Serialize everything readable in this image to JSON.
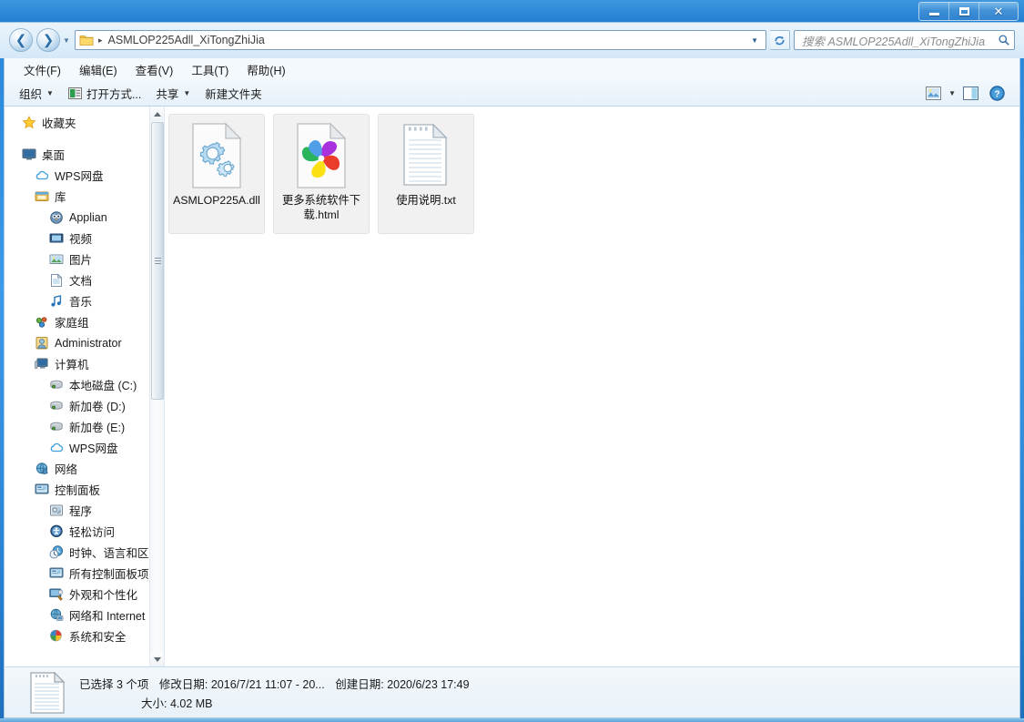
{
  "window": {
    "title": "",
    "controls": {
      "minimize_label": "最小化",
      "maximize_label": "最大化",
      "close_label": "关闭"
    }
  },
  "navbar": {
    "back_label": "后退",
    "forward_label": "前进",
    "recent_pages_label": "最近的页面",
    "address_path": "ASMLOP225Adll_XiTongZhiJia",
    "address_separator": "▸",
    "refresh_label": "刷新",
    "search_placeholder": "搜索 ASMLOP225Adll_XiTongZhiJia"
  },
  "menubar": {
    "items": [
      {
        "label": "文件(F)",
        "name": "menu-file"
      },
      {
        "label": "编辑(E)",
        "name": "menu-edit"
      },
      {
        "label": "查看(V)",
        "name": "menu-view"
      },
      {
        "label": "工具(T)",
        "name": "menu-tools"
      },
      {
        "label": "帮助(H)",
        "name": "menu-help"
      }
    ]
  },
  "toolbar": {
    "organize_label": "组织",
    "open_with_label": "打开方式...",
    "share_label": "共享",
    "new_folder_label": "新建文件夹",
    "change_view_label": "更改您的视图",
    "preview_pane_label": "显示预览窗格",
    "help_label": "获取帮助"
  },
  "sidebar": {
    "items": [
      {
        "label": "收藏夹",
        "icon": "star-icon",
        "level": 0,
        "gap_after": true
      },
      {
        "label": "桌面",
        "icon": "desktop-icon",
        "level": 0
      },
      {
        "label": "WPS网盘",
        "icon": "cloud-icon",
        "level": 1
      },
      {
        "label": "库",
        "icon": "library-icon",
        "level": 1
      },
      {
        "label": "Applian",
        "icon": "owl-icon",
        "level": 2
      },
      {
        "label": "视频",
        "icon": "video-icon",
        "level": 2
      },
      {
        "label": "图片",
        "icon": "picture-icon",
        "level": 2
      },
      {
        "label": "文档",
        "icon": "document-icon",
        "level": 2
      },
      {
        "label": "音乐",
        "icon": "music-icon",
        "level": 2
      },
      {
        "label": "家庭组",
        "icon": "homegroup-icon",
        "level": 1
      },
      {
        "label": "Administrator",
        "icon": "user-icon",
        "level": 1
      },
      {
        "label": "计算机",
        "icon": "computer-icon",
        "level": 1
      },
      {
        "label": "本地磁盘 (C:)",
        "icon": "harddisk-icon",
        "level": 2
      },
      {
        "label": "新加卷 (D:)",
        "icon": "harddisk-icon",
        "level": 2
      },
      {
        "label": "新加卷 (E:)",
        "icon": "harddisk-icon",
        "level": 2
      },
      {
        "label": "WPS网盘",
        "icon": "cloud-icon",
        "level": 2
      },
      {
        "label": "网络",
        "icon": "network-icon",
        "level": 1
      },
      {
        "label": "控制面板",
        "icon": "controlpanel-icon",
        "level": 1
      },
      {
        "label": "程序",
        "icon": "programs-icon",
        "level": 2
      },
      {
        "label": "轻松访问",
        "icon": "ease-of-access-icon",
        "level": 2
      },
      {
        "label": "时钟、语言和区域",
        "icon": "clock-icon",
        "level": 2
      },
      {
        "label": "所有控制面板项",
        "icon": "controlpanel-icon",
        "level": 2
      },
      {
        "label": "外观和个性化",
        "icon": "appearance-icon",
        "level": 2
      },
      {
        "label": "网络和 Internet",
        "icon": "network-internet-icon",
        "level": 2
      },
      {
        "label": "系统和安全",
        "icon": "system-security-icon",
        "level": 2
      }
    ]
  },
  "files": [
    {
      "name": "ASMLOP225A.dll",
      "icon": "dll-gear-file-icon",
      "selected": true
    },
    {
      "name": "更多系统软件下载.html",
      "icon": "html-pinwheel-file-icon",
      "selected": true
    },
    {
      "name": "使用说明.txt",
      "icon": "text-file-icon",
      "selected": true
    }
  ],
  "statusbar": {
    "selected_count_text": "已选择 3 个项",
    "modified_label": "修改日期:",
    "modified_value": "2016/7/21 11:07 - 20...",
    "created_label": "创建日期:",
    "created_value": "2020/6/23 17:49",
    "size_label": "大小:",
    "size_value": "4.02 MB"
  },
  "colors": {
    "titlebar_blue": "#2f8bd9",
    "frame_border": "#a8c8e4",
    "content_bg": "#ffffff",
    "selection_bg": "#f1f1f1",
    "text": "#1b1b1b"
  }
}
